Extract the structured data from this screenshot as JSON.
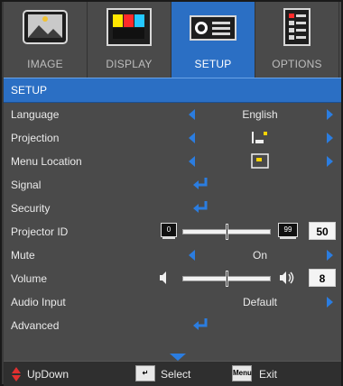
{
  "tabs": [
    {
      "label": "IMAGE",
      "icon": "image-icon",
      "active": false
    },
    {
      "label": "DISPLAY",
      "icon": "display-icon",
      "active": false
    },
    {
      "label": "SETUP",
      "icon": "setup-icon",
      "active": true
    },
    {
      "label": "OPTIONS",
      "icon": "options-icon",
      "active": false
    }
  ],
  "section_title": "SETUP",
  "menu": {
    "language": {
      "label": "Language",
      "value": "English"
    },
    "projection": {
      "label": "Projection"
    },
    "menu_location": {
      "label": "Menu Location"
    },
    "signal": {
      "label": "Signal"
    },
    "security": {
      "label": "Security"
    },
    "projector_id": {
      "label": "Projector ID",
      "min": "0",
      "max": "99",
      "value": "50",
      "level": 0.5
    },
    "mute": {
      "label": "Mute",
      "value": "On"
    },
    "volume": {
      "label": "Volume",
      "value": "8",
      "level": 0.5
    },
    "audio_input": {
      "label": "Audio Input",
      "value": "Default"
    },
    "advanced": {
      "label": "Advanced"
    }
  },
  "footer": {
    "updown": "UpDown",
    "select_key": "↵",
    "select": "Select",
    "menu_key": "Menu",
    "exit": "Exit"
  },
  "colors": {
    "accent": "#2b6fc4",
    "arrow": "#2b7de0",
    "panel": "#4a4a4a"
  }
}
